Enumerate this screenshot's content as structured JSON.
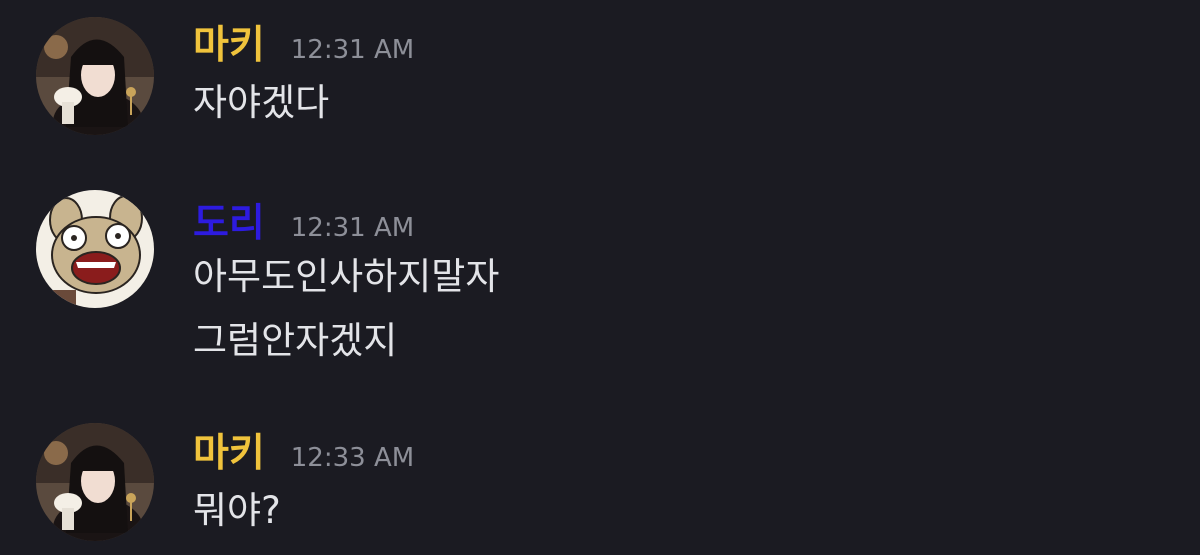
{
  "messages": [
    {
      "author": "마키",
      "author_color": "#f0c33c",
      "time": "12:31 AM",
      "avatar_icon": "user-avatar-photo",
      "lines": [
        "자야겠다"
      ]
    },
    {
      "author": "도리",
      "author_color": "#2d1be0",
      "time": "12:31 AM",
      "avatar_icon": "cartoon-rabbit-avatar",
      "lines": [
        "아무도인사하지말자",
        "그럼안자겠지"
      ]
    },
    {
      "author": "마키",
      "author_color": "#f0c33c",
      "time": "12:33 AM",
      "avatar_icon": "user-avatar-photo",
      "lines": [
        "뭐야?"
      ]
    }
  ]
}
